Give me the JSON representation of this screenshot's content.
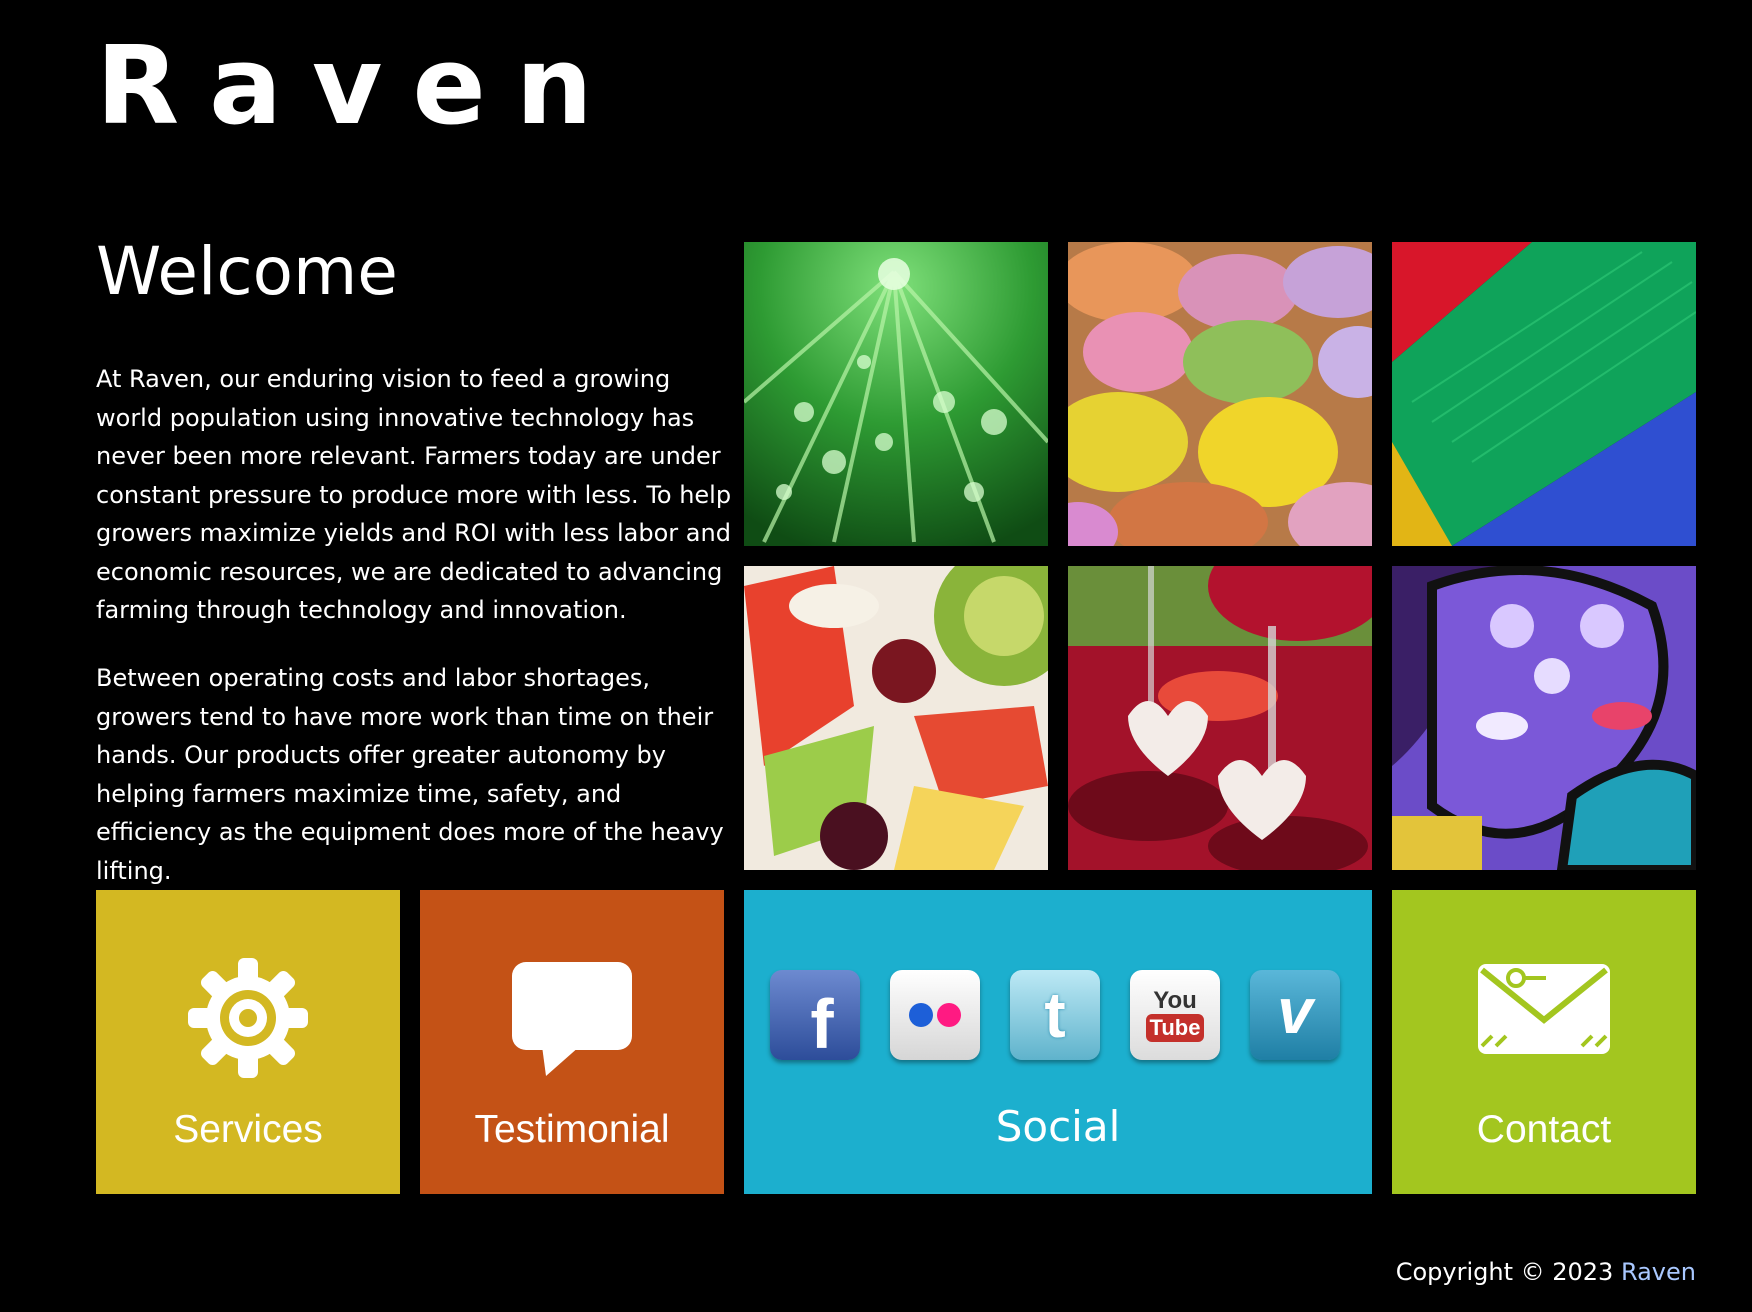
{
  "header": {
    "logo": "Raven"
  },
  "welcome": {
    "title": "Welcome",
    "paragraphs": [
      "At Raven, our enduring vision to feed a growing world population using innovative technology has never been more relevant. Farmers today are under constant pressure to produce more with less. To help growers maximize yields and ROI with less labor and economic resources, we are dedicated to advancing farming through technology and innovation.",
      "Between operating costs and labor shortages, growers tend to have more work than time on their hands. Our products offer greater autonomy by helping farmers maximize time, safety, and efficiency as the equipment does more of the heavy lifting."
    ]
  },
  "gallery": [
    {
      "name": "leaf-with-water-drops"
    },
    {
      "name": "sugared-almonds"
    },
    {
      "name": "thread-spools"
    },
    {
      "name": "fruit-salad"
    },
    {
      "name": "wine-glasses-with-hearts"
    },
    {
      "name": "graffiti-wall"
    }
  ],
  "menu": {
    "services": {
      "label": "Services",
      "color": "#d3b822",
      "icon": "gear-icon"
    },
    "testimonial": {
      "label": "Testimonial",
      "color": "#c45216",
      "icon": "speech-bubble-icon"
    },
    "social": {
      "label": "Social",
      "color": "#1cafce",
      "icons": [
        {
          "name": "facebook",
          "glyph": "f"
        },
        {
          "name": "flickr",
          "glyph": "●●"
        },
        {
          "name": "twitter",
          "glyph": "t"
        },
        {
          "name": "youtube",
          "glyph_top": "You",
          "glyph_bottom": "Tube"
        },
        {
          "name": "vimeo",
          "glyph": "v"
        }
      ]
    },
    "contact": {
      "label": "Contact",
      "color": "#a3c61f",
      "icon": "envelope-icon"
    }
  },
  "footer": {
    "copyright": "Copyright © 2023",
    "brand": "Raven"
  }
}
